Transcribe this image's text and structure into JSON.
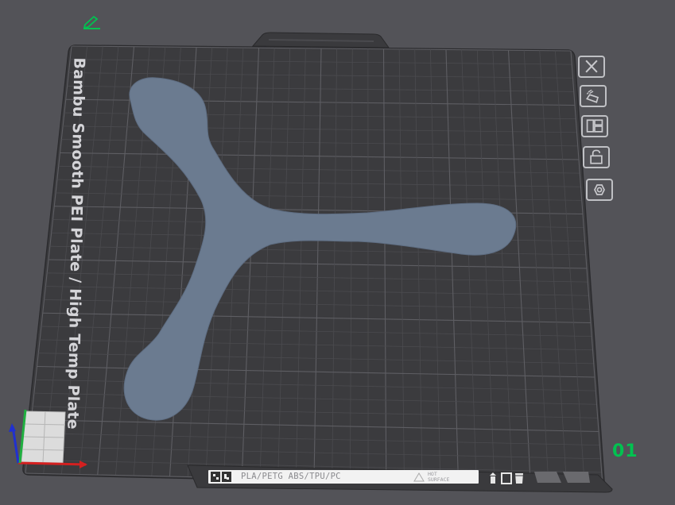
{
  "plate": {
    "name": "Bambu Smooth PEI Plate / High Temp Plate",
    "filaments": "PLA/PETG ABS/TPU/PC",
    "hot_surface": [
      "HOT",
      "SURFACE"
    ],
    "number": "01"
  },
  "side_toolbar": [
    {
      "name": "close-icon"
    },
    {
      "name": "auto-orient-icon"
    },
    {
      "name": "arrange-icon"
    },
    {
      "name": "lock-icon"
    },
    {
      "name": "plate-settings-icon"
    }
  ],
  "colors": {
    "background": "#535358",
    "bed": "#3b3b3e",
    "grid": "#57575b",
    "model": "#6b7b90",
    "plate_number": "#00c250",
    "edit_icon": "#00c250"
  }
}
